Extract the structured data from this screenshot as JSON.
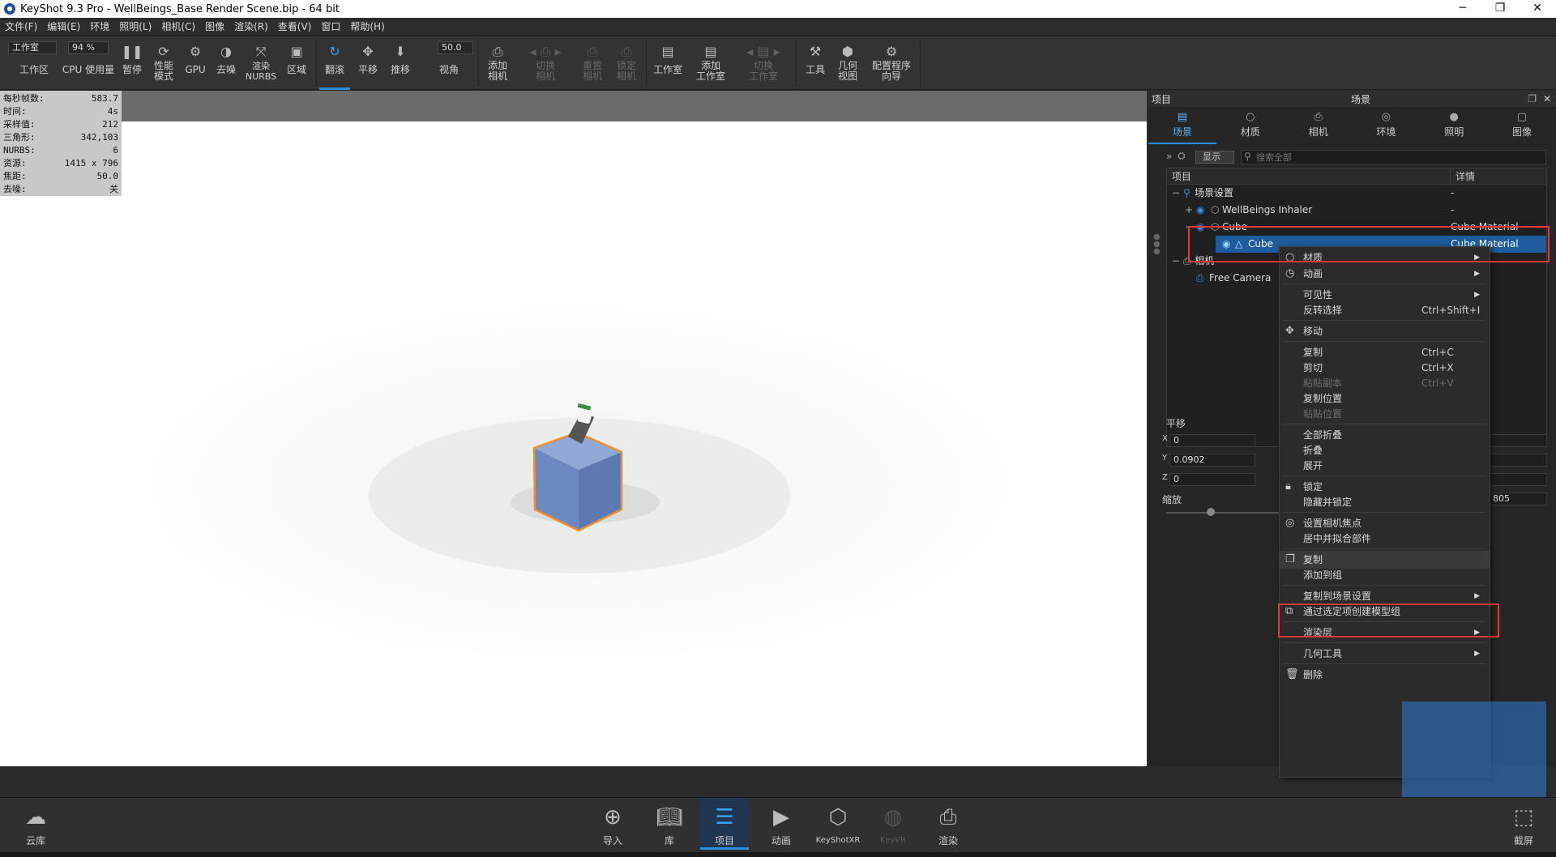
{
  "window": {
    "title": "KeyShot 9.3 Pro  - WellBeings_Base Render Scene.bip  - 64 bit",
    "min": "─",
    "max": "❐",
    "close": "✕"
  },
  "menu": [
    "文件(F)",
    "编辑(E)",
    "环境",
    "照明(L)",
    "相机(C)",
    "图像",
    "渲染(R)",
    "查看(V)",
    "窗口",
    "帮助(H)"
  ],
  "toolbar": {
    "workspace_select": "工作室",
    "cpu_percent": "94 %",
    "fov_value": "50.0",
    "buttons": {
      "workarea": "工作区",
      "cpu_usage": "CPU 使用量",
      "pause": "暂停",
      "perf_mode": "性能\n模式",
      "gpu": "GPU",
      "denoise": "去噪",
      "render_nurbs": "渲染\nNURBS",
      "region": "区域",
      "tumble": "翻滚",
      "pan": "平移",
      "dolly": "推移",
      "fov": "视角",
      "add_camera": "添加\n相机",
      "switch_camera": "切换\n相机",
      "reset_camera": "重置\n相机",
      "lock_camera": "锁定\n相机",
      "studio": "工作室",
      "add_studio": "添加\n工作室",
      "switch_studio": "切换\n工作室",
      "tools": "工具",
      "geometry_view": "几何\n视图",
      "config_wizard": "配置程序\n向导"
    }
  },
  "stats": [
    {
      "label": "每秒帧数:",
      "value": "583.7"
    },
    {
      "label": "时间:",
      "value": "4s"
    },
    {
      "label": "采样值:",
      "value": "212"
    },
    {
      "label": "三角形:",
      "value": "342,103"
    },
    {
      "label": "NURBS:",
      "value": "6"
    },
    {
      "label": "资源:",
      "value": "1415 x 796"
    },
    {
      "label": "焦距:",
      "value": "50.0"
    },
    {
      "label": "去噪:",
      "value": "关"
    }
  ],
  "panel": {
    "header_left": "项目",
    "header_center": "场景",
    "tabs": [
      "场景",
      "材质",
      "相机",
      "环境",
      "照明",
      "图像"
    ],
    "filter_display": "显示",
    "search_placeholder": "搜索全部",
    "tree_col_item": "项目",
    "tree_col_detail": "详情",
    "tree": [
      {
        "label": "场景设置",
        "detail": "-"
      },
      {
        "label": "WellBeings Inhaler",
        "detail": "-"
      },
      {
        "label": "Cube",
        "detail": "Cube Material"
      },
      {
        "label": "Cube",
        "detail": "Cube Material"
      },
      {
        "label": "相机",
        "detail": ""
      },
      {
        "label": "Free Camera",
        "detail": ""
      }
    ],
    "transform_title": "平移",
    "x": "0",
    "y": "0.0902",
    "z": "0",
    "scale_label": "缩放",
    "scale_value": "805",
    "x_label": "X",
    "y_label": "Y",
    "z_label": "Z"
  },
  "context_menu": [
    {
      "label": "材质",
      "shortcut": "",
      "submenu": true,
      "disabled": false,
      "icon": "material-icon"
    },
    {
      "label": "动画",
      "shortcut": "",
      "submenu": true,
      "disabled": false,
      "icon": "animation-icon"
    },
    {
      "label": "可见性",
      "shortcut": "",
      "submenu": true,
      "disabled": false
    },
    {
      "label": "反转选择",
      "shortcut": "Ctrl+Shift+I",
      "submenu": false,
      "disabled": false
    },
    {
      "label": "移动",
      "shortcut": "",
      "submenu": false,
      "disabled": false,
      "icon": "move-icon"
    },
    {
      "label": "复制",
      "shortcut": "Ctrl+C",
      "submenu": false,
      "disabled": false
    },
    {
      "label": "剪切",
      "shortcut": "Ctrl+X",
      "submenu": false,
      "disabled": false
    },
    {
      "label": "粘贴副本",
      "shortcut": "Ctrl+V",
      "submenu": false,
      "disabled": true
    },
    {
      "label": "复制位置",
      "shortcut": "",
      "submenu": false,
      "disabled": false
    },
    {
      "label": "粘贴位置",
      "shortcut": "",
      "submenu": false,
      "disabled": true
    },
    {
      "label": "全部折叠",
      "shortcut": "",
      "submenu": false,
      "disabled": false
    },
    {
      "label": "折叠",
      "shortcut": "",
      "submenu": false,
      "disabled": false
    },
    {
      "label": "展开",
      "shortcut": "",
      "submenu": false,
      "disabled": false
    },
    {
      "label": "锁定",
      "shortcut": "",
      "submenu": false,
      "disabled": false,
      "icon": "lock-icon"
    },
    {
      "label": "隐藏并锁定",
      "shortcut": "",
      "submenu": false,
      "disabled": false
    },
    {
      "label": "设置相机焦点",
      "shortcut": "",
      "submenu": false,
      "disabled": false,
      "icon": "focus-icon"
    },
    {
      "label": "居中并拟合部件",
      "shortcut": "",
      "submenu": false,
      "disabled": false
    },
    {
      "label": "复制",
      "shortcut": "",
      "submenu": false,
      "disabled": false,
      "icon": "duplicate-icon"
    },
    {
      "label": "添加到组",
      "shortcut": "",
      "submenu": false,
      "disabled": false
    },
    {
      "label": "复制到场景设置",
      "shortcut": "",
      "submenu": true,
      "disabled": false
    },
    {
      "label": "通过选定项创建模型组",
      "shortcut": "",
      "submenu": false,
      "disabled": false,
      "icon": "model-group-icon"
    },
    {
      "label": "渲染层",
      "shortcut": "",
      "submenu": true,
      "disabled": false
    },
    {
      "label": "几何工具",
      "shortcut": "",
      "submenu": true,
      "disabled": false
    },
    {
      "label": "删除",
      "shortcut": "",
      "submenu": false,
      "disabled": false,
      "icon": "delete-icon"
    }
  ],
  "bottom": {
    "cloud": "云库",
    "import": "导入",
    "library": "库",
    "project": "项目",
    "animation": "动画",
    "keyshotxr": "KeyShotXR",
    "keyvr": "KeyVR",
    "render": "渲染",
    "screenshot": "截屏"
  },
  "colors": {
    "accent": "#2a8cde",
    "cube": "#6e8cc4",
    "selection_outline": "#f0902a",
    "highlight_red": "#e53935"
  }
}
